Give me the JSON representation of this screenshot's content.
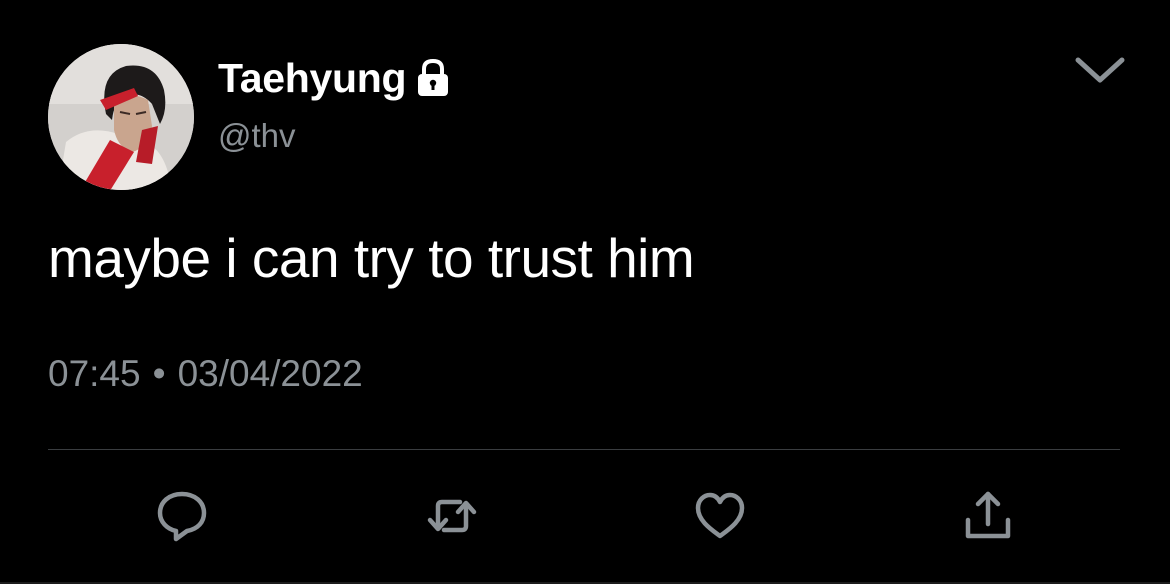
{
  "user": {
    "display_name": "Taehyung",
    "handle": "@thv",
    "protected_icon": "lock-icon",
    "avatar_icon": "avatar-photo"
  },
  "menu": {
    "icon": "chevron-down-icon"
  },
  "tweet": {
    "text": "maybe i can try to trust him",
    "time": "07:45",
    "separator": "•",
    "date": "03/04/2022"
  },
  "actions": [
    {
      "name": "reply",
      "icon": "reply-icon"
    },
    {
      "name": "retweet",
      "icon": "retweet-icon"
    },
    {
      "name": "like",
      "icon": "heart-icon"
    },
    {
      "name": "share",
      "icon": "share-icon"
    }
  ],
  "colors": {
    "background": "#000000",
    "primary_text": "#ffffff",
    "secondary_text": "#8b9196",
    "icon": "#8b9196",
    "divider": "#3a3d40"
  }
}
